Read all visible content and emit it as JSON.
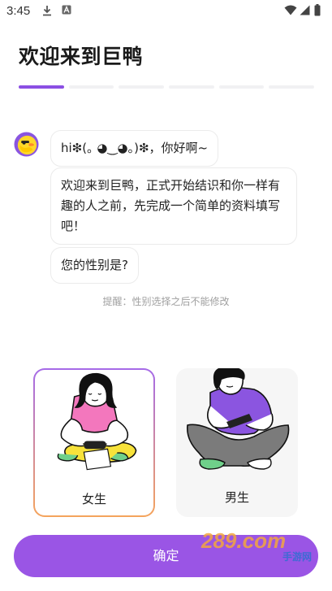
{
  "status_bar": {
    "time": "3:45",
    "icons": [
      "download-icon",
      "notification-a-icon",
      "wifi-icon",
      "cellular-icon",
      "battery-icon"
    ]
  },
  "header": {
    "title": "欢迎来到巨鸭"
  },
  "progress": {
    "total_steps": 6,
    "current_step": 1,
    "active_color": "#8b4fe3"
  },
  "chat": {
    "avatar_icon": "duck-avatar-icon",
    "messages": [
      "hi❇(｡ ◕‿◕｡)❇，你好啊~",
      "欢迎来到巨鸭，正式开始结识和你一样有趣的人之前，先完成一个简单的资料填写吧！",
      "您的性别是?"
    ],
    "hint": "提醒：性别选择之后不能修改"
  },
  "gender_options": [
    {
      "label": "女生",
      "selected": true
    },
    {
      "label": "男生",
      "selected": false
    }
  ],
  "confirm_button": {
    "label": "确定",
    "color": "#9a55e5"
  },
  "watermark": {
    "brand": "289.com",
    "sub": "手游网"
  }
}
